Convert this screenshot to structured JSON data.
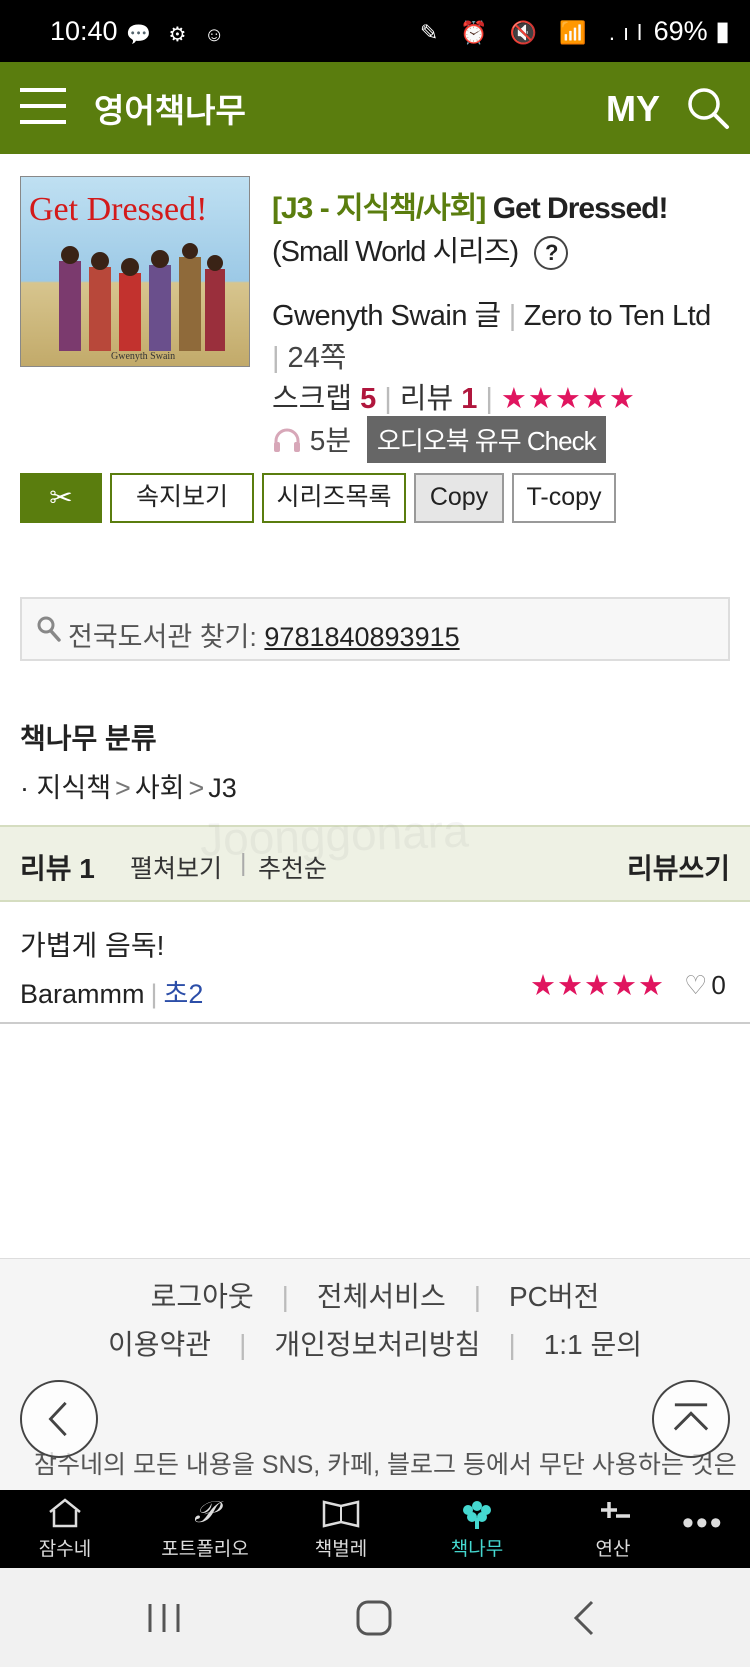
{
  "status_bar": {
    "time": "10:40",
    "left_icons": "💬 ⚙ ☺",
    "right_icons": "✎ ⏰ 🔇 📶 .ıl",
    "battery": "69%"
  },
  "header": {
    "title": "영어책나무",
    "my_label": "MY"
  },
  "book": {
    "cover_title": "Get Dressed!",
    "cover_author": "Gwenyth Swain",
    "category_tag": "[J3 - 지식책/사회]",
    "title": "Get Dressed!",
    "series": "(Small World 시리즈)",
    "help": "?",
    "author": "Gwenyth Swain 글",
    "publisher": "Zero to Ten Ltd",
    "pages": "24쪽",
    "scrap_label": "스크랩",
    "scrap_count": "5",
    "review_label": "리뷰",
    "review_count": "1",
    "stars": "★★★★★",
    "audio_length": "5분",
    "audio_check": "오디오북 유무 Check"
  },
  "actions": {
    "scrap_icon": "✂",
    "sokji": "속지보기",
    "series_list": "시리즈목록",
    "copy": "Copy",
    "tcopy": "T-copy"
  },
  "library": {
    "label": "전국도서관 찾기:",
    "isbn": "9781840893915"
  },
  "classification": {
    "title": "책나무 분류",
    "bullet": "·",
    "path": [
      "지식책",
      "사회",
      "J3"
    ],
    "arrow": ">"
  },
  "reviews": {
    "header": {
      "count_label": "리뷰 1",
      "expand": "펼쳐보기",
      "divider": "|",
      "sort": "추천순",
      "write": "리뷰쓰기"
    },
    "items": [
      {
        "title": "가볍게 음독!",
        "user": "Barammm",
        "grade": "초2",
        "stars": "★★★★★",
        "likes": "0"
      }
    ]
  },
  "footer": {
    "row1": [
      "로그아웃",
      "전체서비스",
      "PC버전"
    ],
    "row2": [
      "이용약관",
      "개인정보처리방침",
      "1:1 문의"
    ],
    "notice": "잠수네의 모든 내용을 SNS, 카페, 블로그 등에서 무단 사용하는 것은"
  },
  "bottom_nav": [
    {
      "label": "잠수네"
    },
    {
      "label": "포트폴리오"
    },
    {
      "label": "책벌레"
    },
    {
      "label": "책나무"
    },
    {
      "label": "연산"
    }
  ],
  "more": "•••",
  "watermark": "Joonggonara",
  "colors": {
    "brand_green": "#5a7d0e",
    "star_pink": "#e0155f",
    "count_red": "#b0163d",
    "active_teal": "#45d8d0"
  }
}
